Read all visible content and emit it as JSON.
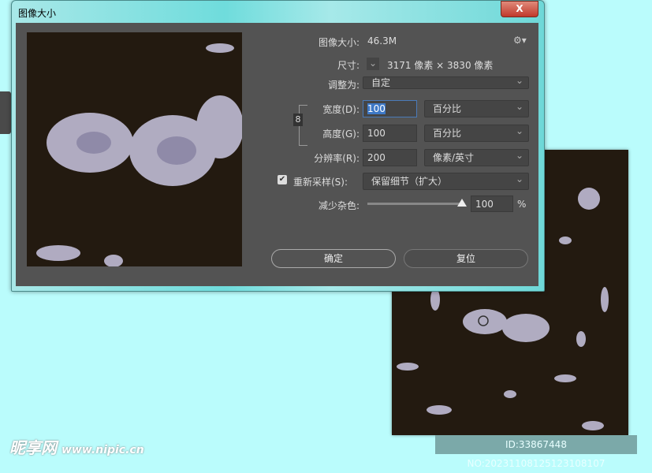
{
  "window": {
    "title": "图像大小",
    "close_label": "X"
  },
  "dialog": {
    "image_size_label": "图像大小:",
    "image_size_value": "46.3M",
    "dimensions_label": "尺寸:",
    "dimensions_value": "3171 像素 × 3830 像素",
    "fit_to_label": "调整为:",
    "fit_to_value": "自定",
    "width_label": "宽度(D):",
    "width_value": "100",
    "width_unit": "百分比",
    "height_label": "高度(G):",
    "height_value": "100",
    "height_unit": "百分比",
    "resolution_label": "分辨率(R):",
    "resolution_value": "200",
    "resolution_unit": "像素/英寸",
    "resample_label": "重新采样(S):",
    "resample_checked": true,
    "resample_value": "保留细节（扩大）",
    "noise_label": "减少杂色:",
    "noise_value": "100",
    "noise_unit": "%",
    "noise_level_percent": 100,
    "ok_label": "确定",
    "reset_label": "复位"
  },
  "watermark": {
    "logo": "昵享网",
    "site": "www.nipic.cn",
    "id_text": "ID:33867448 NO:20231108125123108107"
  },
  "colors": {
    "panel": "#535353",
    "image_bg": "#231a10",
    "desktop": "#bafcfc",
    "flower": "#c9c6e0"
  }
}
